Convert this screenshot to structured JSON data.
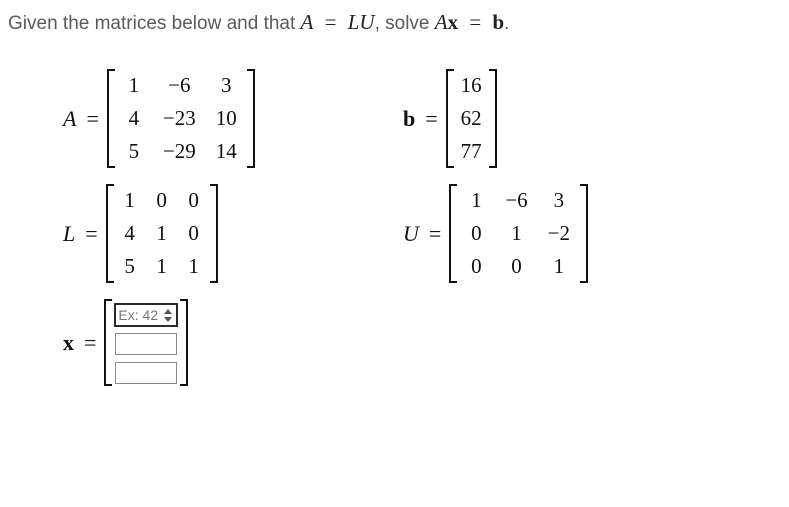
{
  "prompt": {
    "pre": "Given the matrices below and that ",
    "A": "A",
    "eq1": " = ",
    "LU": "LU",
    "mid": ", solve ",
    "Ax_A": "A",
    "Ax_x": "x",
    "eq2": " = ",
    "b": "b",
    "post": "."
  },
  "labels": {
    "A": "A",
    "b": "b",
    "L": "L",
    "U": "U",
    "x": "x",
    "eq": "="
  },
  "A": [
    [
      "1",
      "−6",
      "3"
    ],
    [
      "4",
      "−23",
      "10"
    ],
    [
      "5",
      "−29",
      "14"
    ]
  ],
  "b": [
    [
      "16"
    ],
    [
      "62"
    ],
    [
      "77"
    ]
  ],
  "L": [
    [
      "1",
      "0",
      "0"
    ],
    [
      "4",
      "1",
      "0"
    ],
    [
      "5",
      "1",
      "1"
    ]
  ],
  "U": [
    [
      "1",
      "−6",
      "3"
    ],
    [
      "0",
      "1",
      "−2"
    ],
    [
      "0",
      "0",
      "1"
    ]
  ],
  "x_input": {
    "placeholder": "Ex: 42",
    "values": [
      "",
      "",
      ""
    ]
  }
}
